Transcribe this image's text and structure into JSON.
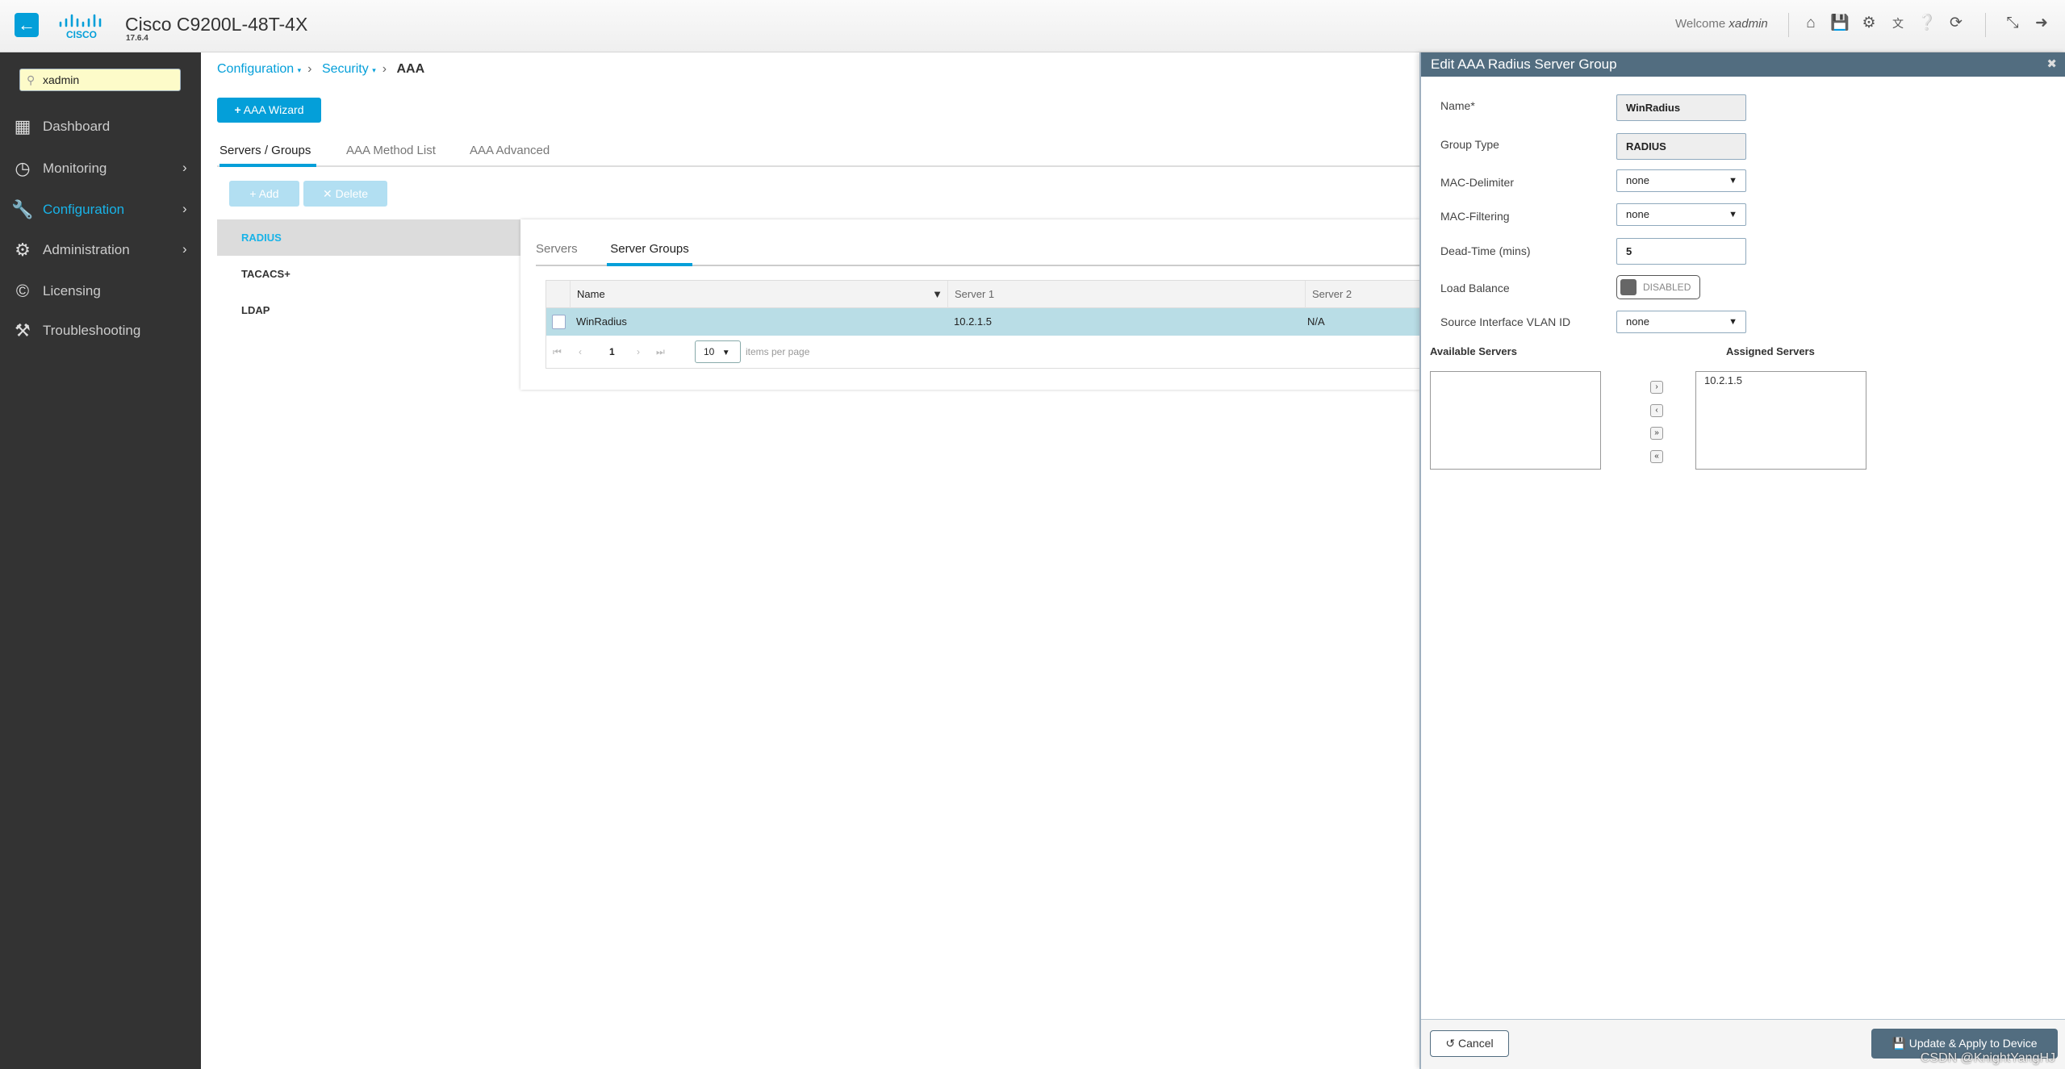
{
  "header": {
    "title": "Cisco C9200L-48T-4X",
    "version": "17.6.4",
    "logo_text": "cisco",
    "welcome": "Welcome",
    "user": "xadmin",
    "icons": [
      "home-icon",
      "save-icon",
      "gear-icon",
      "translate-icon",
      "help-icon",
      "refresh-icon",
      "expand-icon",
      "logout-icon"
    ]
  },
  "sidebar": {
    "search_value": "xadmin",
    "items": [
      {
        "label": "Dashboard",
        "icon": "dashboard-icon"
      },
      {
        "label": "Monitoring",
        "icon": "gauge-icon"
      },
      {
        "label": "Configuration",
        "icon": "wrench-icon",
        "active": true
      },
      {
        "label": "Administration",
        "icon": "gear-icon"
      },
      {
        "label": "Licensing",
        "icon": "license-icon"
      },
      {
        "label": "Troubleshooting",
        "icon": "tools-icon"
      }
    ]
  },
  "breadcrumb": [
    "Configuration",
    "Security",
    "AAA"
  ],
  "wizard_label": "AAA Wizard",
  "tabs": [
    "Servers / Groups",
    "AAA Method List",
    "AAA Advanced"
  ],
  "toolbar": {
    "add": "Add",
    "delete": "Delete"
  },
  "left_list": [
    "RADIUS",
    "TACACS+",
    "LDAP"
  ],
  "inner_tabs": [
    "Servers",
    "Server Groups"
  ],
  "table": {
    "columns": [
      "Name",
      "Server 1",
      "Server 2"
    ],
    "rows": [
      {
        "name": "WinRadius",
        "server1": "10.2.1.5",
        "server2": "N/A"
      }
    ],
    "page": "1",
    "per_page": "10",
    "per_page_label": "items per page"
  },
  "drawer": {
    "title": "Edit AAA Radius Server Group",
    "fields": {
      "name_label": "Name*",
      "name": "WinRadius",
      "group_type_label": "Group Type",
      "group_type": "RADIUS",
      "mac_delimiter_label": "MAC-Delimiter",
      "mac_delimiter": "none",
      "mac_filtering_label": "MAC-Filtering",
      "mac_filtering": "none",
      "dead_time_label": "Dead-Time (mins)",
      "dead_time": "5",
      "load_balance_label": "Load Balance",
      "load_balance": "DISABLED",
      "vlan_label": "Source Interface VLAN ID",
      "vlan": "none"
    },
    "available_label": "Available Servers",
    "assigned_label": "Assigned Servers",
    "available": [],
    "assigned": [
      "10.2.1.5"
    ],
    "cancel": "Cancel",
    "update": "Update & Apply to Device"
  },
  "watermark": "CSDN @KnightYangHJ"
}
